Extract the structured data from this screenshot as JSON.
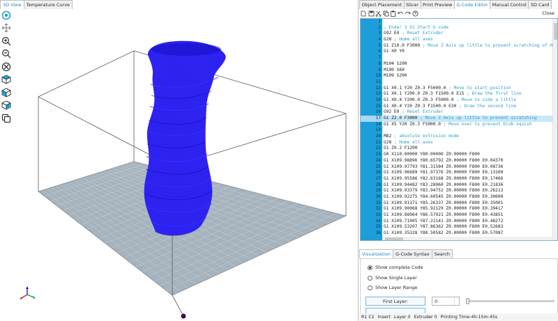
{
  "left_tabs": [
    {
      "label": "3D View",
      "active": true
    },
    {
      "label": "Temperature Curve",
      "active": false
    }
  ],
  "view_toolbar": [
    {
      "icon": "target-icon"
    },
    {
      "icon": "move-icon"
    },
    {
      "icon": "zoom-in-icon"
    },
    {
      "icon": "zoom-out-icon"
    },
    {
      "icon": "reset-view-icon"
    },
    {
      "icon": "top-view-cube-icon"
    },
    {
      "icon": "front-view-cube-icon"
    },
    {
      "icon": "side-view-cube-icon"
    },
    {
      "icon": "copy-layers-icon"
    }
  ],
  "right_tabs": [
    {
      "label": "Object Placement",
      "active": false
    },
    {
      "label": "Slicer",
      "active": false
    },
    {
      "label": "Print Preview",
      "active": false
    },
    {
      "label": "G-Code Editor",
      "active": true
    },
    {
      "label": "Manual Control",
      "active": false
    },
    {
      "label": "SD Card",
      "active": false
    }
  ],
  "editor_toolbar": {
    "icons": [
      "load-icon",
      "save-icon",
      "cut-icon",
      "copy-icon",
      "paste-icon",
      "undo-icon",
      "redo-icon",
      "help-icon"
    ],
    "close_label": "Close"
  },
  "gcode": {
    "highlighted_line": 17,
    "lines": [
      {
        "n": "1",
        "cmd": "",
        "cmt": ""
      },
      {
        "n": "2",
        "cmd": "",
        "cmt": "; Ender 3 S1 Start G-code"
      },
      {
        "n": "3",
        "cmd": "G92 E0 ",
        "cmt": "; Reset Extruder"
      },
      {
        "n": "4",
        "cmd": "G28 ",
        "cmt": "; Home all axes"
      },
      {
        "n": "5",
        "cmd": "G1 Z10.0 F3000 ",
        "cmt": "; Move Z Axis up little to prevent scratching of Heat Bed"
      },
      {
        "n": "6",
        "cmd": "G1 X0 Y0",
        "cmt": ""
      },
      {
        "n": "7",
        "cmd": "",
        "cmt": ""
      },
      {
        "n": "8",
        "cmd": "M104 S200",
        "cmt": ""
      },
      {
        "n": "9",
        "cmd": "M190 S60",
        "cmt": ""
      },
      {
        "n": "10",
        "cmd": "M109 S200",
        "cmt": ""
      },
      {
        "n": "11",
        "cmd": "",
        "cmt": ""
      },
      {
        "n": "12",
        "cmd": "G1 X0.1 Y20 Z0.3 F5000.0 ",
        "cmt": "; Move to start position"
      },
      {
        "n": "13",
        "cmd": "G1 X0.1 Y200.0 Z0.3 F1500.0 E15 ",
        "cmt": "; Draw the first line"
      },
      {
        "n": "14",
        "cmd": "G1 X0.4 Y200.0 Z0.3 F5000.0 ",
        "cmt": "; Move to side a little"
      },
      {
        "n": "15",
        "cmd": "G1 X0.4 Y20 Z0.3 F1500.0 E30 ",
        "cmt": "; Draw the second line"
      },
      {
        "n": "16",
        "cmd": "G92 E0 ",
        "cmt": "; Reset Extruder"
      },
      {
        "n": "17",
        "cmd": "G1 Z2.0 F3000 ",
        "cmt": "; Move Z Axis up little to prevent scratching"
      },
      {
        "n": "18",
        "cmd": "G1 X5 Y20 Z0.3 F5000.0 ",
        "cmt": "; Move over to prevent blob squish"
      },
      {
        "n": "19",
        "cmd": "",
        "cmt": ""
      },
      {
        "n": "20",
        "cmd": "M82 ",
        "cmt": "; absolute extrusion mode"
      },
      {
        "n": "21",
        "cmd": "G28 ",
        "cmt": "; Home all axes"
      },
      {
        "n": "22",
        "cmd": "G1 Z0.2 F1200",
        "cmt": ""
      },
      {
        "n": "23",
        "cmd": "G0 X110.00000 Y80.00000 Z0.00000 F800",
        "cmt": ""
      },
      {
        "n": "24",
        "cmd": "G1 X109.98896 Y80.65792 Z0.00000 F800 E0.04370",
        "cmt": ""
      },
      {
        "n": "25",
        "cmd": "G1 X109.97793 Y81.31584 Z0.00000 F800 E0.08736",
        "cmt": ""
      },
      {
        "n": "26",
        "cmd": "G1 X109.96689 Y81.97376 Z0.00000 F800 E0.13100",
        "cmt": ""
      },
      {
        "n": "27",
        "cmd": "G1 X109.95586 Y82.63168 Z0.00000 F800 E0.17466",
        "cmt": ""
      },
      {
        "n": "28",
        "cmd": "G1 X109.94482 Y83.28960 Z0.00000 F800 E0.21836",
        "cmt": ""
      },
      {
        "n": "29",
        "cmd": "G1 X109.93379 Y83.94752 Z0.00000 F800 E0.26213",
        "cmt": ""
      },
      {
        "n": "30",
        "cmd": "G1 X109.92275 Y84.60545 Z0.00000 F800 E0.30600",
        "cmt": ""
      },
      {
        "n": "31",
        "cmd": "G1 X109.91171 Y85.26337 Z0.00000 F800 E0.35001",
        "cmt": ""
      },
      {
        "n": "32",
        "cmd": "G1 X109.90068 Y85.92129 Z0.00000 F800 E0.39417",
        "cmt": ""
      },
      {
        "n": "33",
        "cmd": "G1 X109.88964 Y86.57921 Z0.00000 F800 E0.43851",
        "cmt": ""
      },
      {
        "n": "34",
        "cmd": "G1 X109.71005 Y87.22141 Z0.00000 F800 E0.48272",
        "cmt": ""
      },
      {
        "n": "35",
        "cmd": "G1 X109.53207 Y87.86362 Z0.00000 F800 E0.52683",
        "cmt": ""
      },
      {
        "n": "36",
        "cmd": "G1 X109.35328 Y88.50582 Z0.00000 F800 E0.57087",
        "cmt": ""
      }
    ]
  },
  "bottom_tabs": [
    {
      "label": "Visualization",
      "active": true
    },
    {
      "label": "G-Code Syntax",
      "active": false
    },
    {
      "label": "Search",
      "active": false
    }
  ],
  "visualization": {
    "options": [
      {
        "label": "Show complete Code",
        "selected": true
      },
      {
        "label": "Show Single Layer",
        "selected": false
      },
      {
        "label": "Show Layer Range",
        "selected": false
      }
    ],
    "first_layer_label": "First Layer:",
    "first_layer_value": "0"
  },
  "status": {
    "position": "R1  C1",
    "mode": "Insert",
    "layer": "Layer 0",
    "extruder": "Extruder 0",
    "print_time": "Printing Time:4h:15m:45s"
  },
  "colors": {
    "accent": "#1d9ed8",
    "model": "#1f16e6",
    "bed": "#a6b3bd",
    "comment": "#2a9dc9"
  }
}
